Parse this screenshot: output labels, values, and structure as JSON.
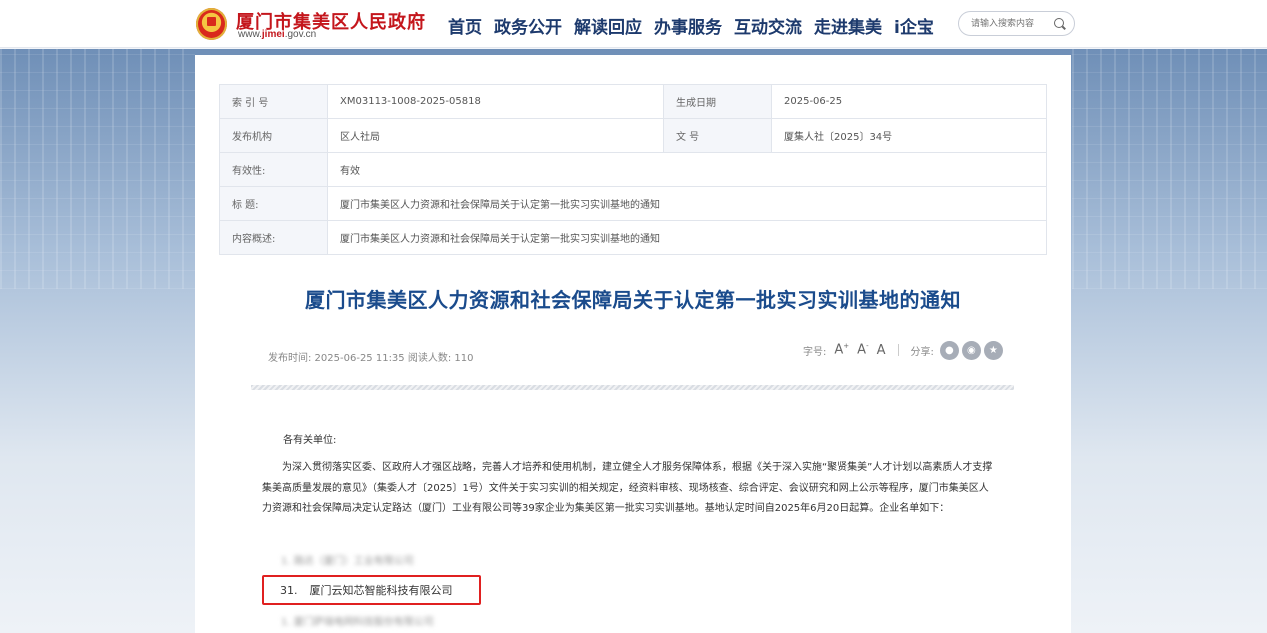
{
  "header": {
    "site_name": "厦门市集美区人民政府",
    "site_url_prefix": "www.",
    "site_url_brand": "jimei",
    "site_url_suffix": ".gov.cn",
    "nav": [
      "首页",
      "政务公开",
      "解读回应",
      "办事服务",
      "互动交流",
      "走进集美",
      "i企宝"
    ],
    "search_placeholder": "请输入搜索内容"
  },
  "meta": {
    "index_label": "索 引 号",
    "index_value": "XM03113-1008-2025-05818",
    "date_label": "生成日期",
    "date_value": "2025-06-25",
    "org_label": "发布机构",
    "org_value": "区人社局",
    "doc_no_label": "文 号",
    "doc_no_value": "厦集人社〔2025〕34号",
    "validity_label": "有效性:",
    "validity_value": "有效",
    "title_label": "标 题:",
    "title_value": "厦门市集美区人力资源和社会保障局关于认定第一批实习实训基地的通知",
    "summary_label": "内容概述:",
    "summary_value": "厦门市集美区人力资源和社会保障局关于认定第一批实习实训基地的通知"
  },
  "article": {
    "title": "厦门市集美区人力资源和社会保障局关于认定第一批实习实训基地的通知",
    "publish_info": "发布时间: 2025-06-25 11:35 阅读人数:  110",
    "font_size_label": "字号:",
    "font_large": "A",
    "font_medium": "A",
    "font_small": "A",
    "share_label": "分享:",
    "greeting": "各有关单位:",
    "paragraph": "为深入贯彻落实区委、区政府人才强区战略，完善人才培养和使用机制，建立健全人才服务保障体系，根据《关于深入实施“聚贤集美”人才计划以高素质人才支撑集美高质量发展的意见》（集委人才〔2025〕1号）文件关于实习实训的相关规定，经资料审核、现场核查、综合评定、会议研究和网上公示等程序，厦门市集美区人力资源和社会保障局决定认定路达（厦门）工业有限公司等39家企业为集美区第一批实习实训基地。基地认定时间自2025年6月20日起算。企业名单如下：",
    "list_blur_1": "1.   路达（厦门）工业有限公司",
    "highlight_num": "31.",
    "highlight_name": "厦门云知芯智能科技有限公司",
    "list_blur_2": "1.   厦门萨瑞电网科技股份有限公司"
  }
}
